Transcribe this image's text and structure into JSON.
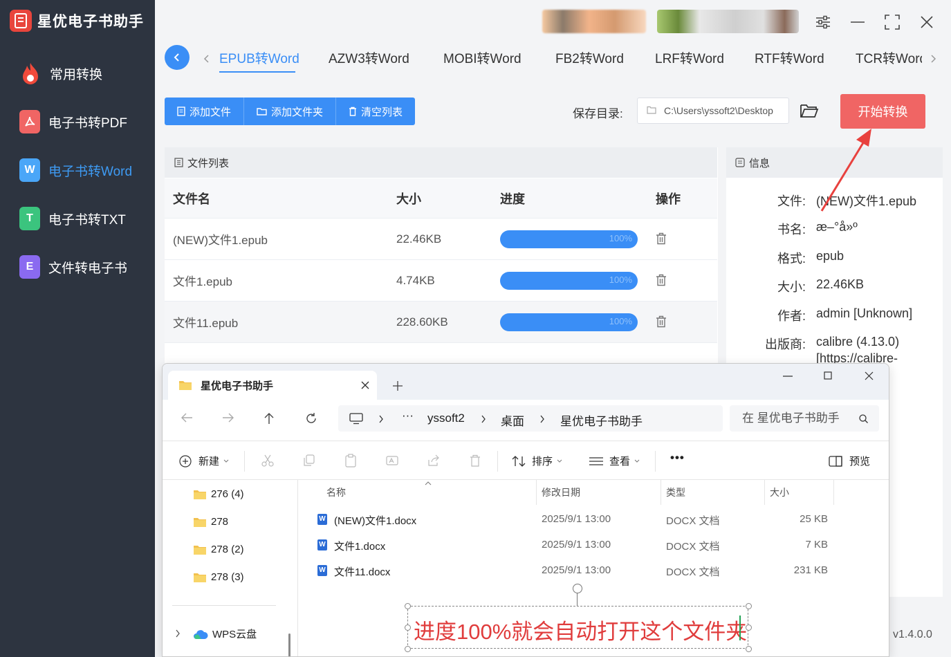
{
  "app": {
    "title": "星优电子书助手",
    "version": "v1.4.0.0"
  },
  "colors": {
    "accent": "#3a8ef6",
    "danger": "#f06564",
    "sidebar_bg": "#2d3440",
    "annotation": "#e03c3c"
  },
  "sidebar": {
    "items": [
      {
        "label": "常用转换",
        "icon": "fire-icon",
        "color": "#f04a3b"
      },
      {
        "label": "电子书转PDF",
        "icon": "pdf-icon",
        "color": "#f06564"
      },
      {
        "label": "电子书转Word",
        "icon": "word-icon",
        "color": "#4aa6f8",
        "glyph": "W"
      },
      {
        "label": "电子书转TXT",
        "icon": "txt-icon",
        "color": "#3bc47e",
        "glyph": "T"
      },
      {
        "label": "文件转电子书",
        "icon": "ebook-icon",
        "color": "#8a6af0",
        "glyph": "E"
      }
    ]
  },
  "tabs": [
    "EPUB转Word",
    "AZW3转Word",
    "MOBI转Word",
    "FB2转Word",
    "LRF转Word",
    "RTF转Word",
    "TCR转Word"
  ],
  "toolbar": {
    "add_file": "添加文件",
    "add_folder": "添加文件夹",
    "clear_list": "清空列表",
    "save_dir_label": "保存目录:",
    "save_dir_value": "C:\\Users\\yssoft2\\Desktop",
    "start": "开始转换"
  },
  "file_list": {
    "title": "文件列表",
    "columns": [
      "文件名",
      "大小",
      "进度",
      "操作"
    ],
    "rows": [
      {
        "name": "(NEW)文件1.epub",
        "size": "22.46KB",
        "progress": "100%"
      },
      {
        "name": "文件1.epub",
        "size": "4.74KB",
        "progress": "100%"
      },
      {
        "name": "文件11.epub",
        "size": "228.60KB",
        "progress": "100%"
      }
    ]
  },
  "info": {
    "title": "信息",
    "fields": [
      {
        "key": "文件:",
        "value": "(NEW)文件1.epub"
      },
      {
        "key": "书名:",
        "value": "æ–°å»º"
      },
      {
        "key": "格式:",
        "value": "epub"
      },
      {
        "key": "大小:",
        "value": "22.46KB"
      },
      {
        "key": "作者:",
        "value": "admin [Unknown]"
      },
      {
        "key": "出版商:",
        "value": "calibre (4.13.0)"
      },
      {
        "key": "",
        "value": "[https://calibre-"
      }
    ]
  },
  "explorer": {
    "tab_title": "星优电子书助手",
    "breadcrumbs": [
      "yssoft2",
      "桌面",
      "星优电子书助手"
    ],
    "search_placeholder": "在 星优电子书助手",
    "toolbar": {
      "new": "新建",
      "sort": "排序",
      "view": "查看",
      "more": "•••",
      "preview": "预览"
    },
    "tree": [
      "276 (4)",
      "278",
      "278 (2)",
      "278 (3)",
      "WPS云盘"
    ],
    "columns": [
      "名称",
      "修改日期",
      "类型",
      "大小"
    ],
    "files": [
      {
        "name": "(NEW)文件1.docx",
        "date": "2025/9/1 13:00",
        "type": "DOCX 文档",
        "size": "25 KB"
      },
      {
        "name": "文件1.docx",
        "date": "2025/9/1 13:00",
        "type": "DOCX 文档",
        "size": "7 KB"
      },
      {
        "name": "文件11.docx",
        "date": "2025/9/1 13:00",
        "type": "DOCX 文档",
        "size": "231 KB"
      }
    ]
  },
  "annotation": {
    "text": "进度100%就会自动打开这个文件夹"
  }
}
